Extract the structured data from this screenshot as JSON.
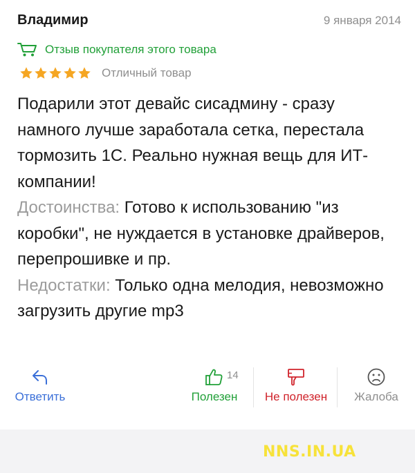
{
  "review": {
    "author": "Владимир",
    "date": "9 января 2014",
    "buyer_badge": "Отзыв покупателя этого товара",
    "rating": {
      "stars": 5,
      "max": 5,
      "label": "Отличный товар",
      "star_color": "#f5a623"
    },
    "text": "Подарили этот девайс сисадмину - сразу намного лучше заработала сетка, перестала тормозить 1С. Реально нужная вещь для ИТ-компании!",
    "pros_label": "Достоинства:",
    "pros_text": "Готово к использованию \"из коробки\", не нуждается в установке драйверов, перепрошивке и пр.",
    "cons_label": "Недостатки:",
    "cons_text": "Только одна мелодия, невозможно загрузить другие mp3"
  },
  "actions": {
    "reply": {
      "label": "Ответить",
      "icon": "reply-arrow-icon",
      "color": "#3a6fd8"
    },
    "useful": {
      "label": "Полезен",
      "count": "14",
      "icon": "thumbs-up-icon",
      "color": "#21a038"
    },
    "not_useful": {
      "label": "Не полезен",
      "icon": "thumbs-down-icon",
      "color": "#d0232b"
    },
    "complaint": {
      "label": "Жалоба",
      "icon": "sad-face-icon",
      "color": "#8e8e8e"
    }
  },
  "watermark": "NNS.IN.UA",
  "colors": {
    "accent_green": "#21a038",
    "accent_blue": "#3a6fd8",
    "accent_red": "#d0232b",
    "muted_text": "#9b9b9b",
    "watermark": "#f7e23a"
  }
}
